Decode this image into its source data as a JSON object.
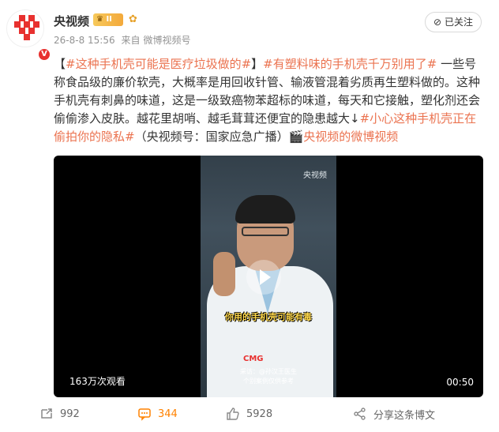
{
  "header": {
    "username": "央视频",
    "vip_level": "II",
    "timestamp": "26-8-8 15:56",
    "source_prefix": "来自",
    "source": "微博视频号",
    "follow_label": "已关注"
  },
  "post": {
    "segments": [
      {
        "text": "【",
        "highlight": false
      },
      {
        "text": "#这种手机壳可能是医疗垃圾做的#",
        "highlight": true
      },
      {
        "text": "】",
        "highlight": false
      },
      {
        "text": "#有塑料味的手机壳千万别用了#",
        "highlight": true
      },
      {
        "text": " 一些号称食品级的廉价软壳，大概率是用回收针管、输液管混着劣质再生塑料做的。这种手机壳有刺鼻的味道，这是一级致癌物苯超标的味道，每天和它接触，塑化剂还会偷偷渗入皮肤。越花里胡哨、越毛茸茸还便宜的隐患越大↓",
        "highlight": false
      },
      {
        "text": "#小心这种手机壳正在偷拍你的隐私#",
        "highlight": true
      },
      {
        "text": "（央视频号：国家应急广播）",
        "highlight": false
      },
      {
        "text": "🎬央视频的微博视频",
        "highlight": true
      }
    ]
  },
  "video": {
    "views": "163万次观看",
    "duration": "00:50",
    "watermark": "央视频",
    "caption": "你用的手机壳可能有毒",
    "logo_text": "CMG",
    "sub_line1": "采访：@孙汉王医生",
    "sub_line2": "个别案例仅供参考"
  },
  "actions": {
    "share_count": "992",
    "comment_count": "344",
    "like_count": "5928",
    "share_more_label": "分享这条博文"
  },
  "colors": {
    "accent": "#eb7350",
    "comment": "#ff8200",
    "brand_red": "#e8312f"
  }
}
